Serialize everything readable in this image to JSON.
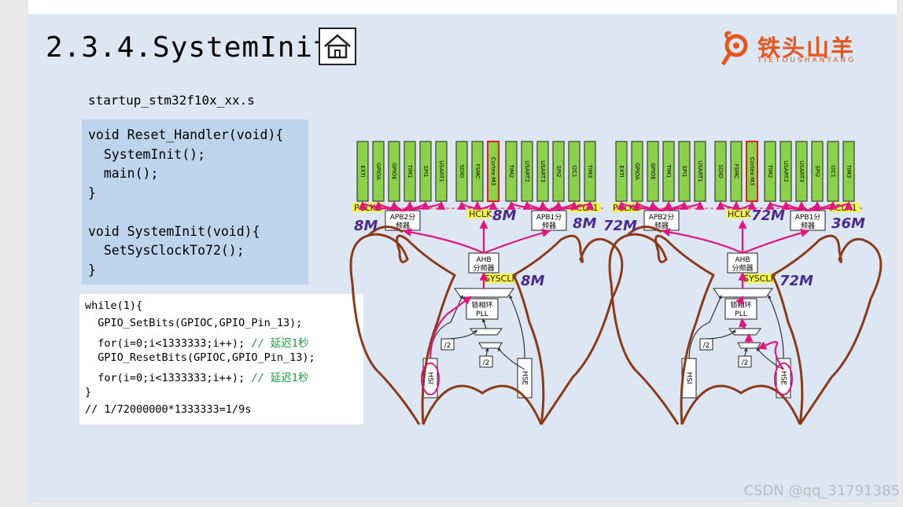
{
  "slide": {
    "title": "2.3.4.SystemInit",
    "home_icon": "home-icon",
    "logo": {
      "cn": "铁头山羊",
      "en": "TIETOUSHANYANG",
      "icon": "goat-head-icon"
    }
  },
  "code": {
    "file": "startup_stm32f10x_xx.s",
    "block1": "void Reset_Handler(void){\n  SystemInit();\n  main();\n}\n\nvoid SystemInit(void){\n  SetSysClockTo72();\n}",
    "loop": [
      {
        "text": "while(1){",
        "comment": ""
      },
      {
        "text": "  GPIO_SetBits(GPIOC,GPIO_Pin_13);",
        "comment": ""
      },
      {
        "text": "  for(i=0;i<1333333;i++);",
        "comment": " // 延迟1秒"
      },
      {
        "text": "  GPIO_ResetBits(GPIOC,GPIO_Pin_13);",
        "comment": ""
      },
      {
        "text": "  for(i=0;i<1333333;i++);",
        "comment": " // 延迟1秒"
      },
      {
        "text": "}",
        "comment": ""
      },
      {
        "text": "// 1/72000000*1333333=1/9s",
        "comment": ""
      }
    ]
  },
  "diagrams": [
    {
      "apb2_periph": [
        "EXTI",
        "GPIOA",
        "GPIOE",
        "TIM1",
        "SPI1",
        "USART1"
      ],
      "ahb_periph": [
        "SDIO",
        "FSMC",
        "Cortex-M3"
      ],
      "apb1_periph": [
        "TIM2",
        "USART2",
        "USART3",
        "SPI2",
        "I2C1",
        "TIM3"
      ],
      "pclk2": "PCLK2",
      "hclk": "HCLK",
      "pclk1": "PCLK1",
      "apb2_box": [
        "APB2分",
        "频器"
      ],
      "apb1_box": [
        "APB1分",
        "频器"
      ],
      "ahb_box": [
        "AHB",
        "分频器"
      ],
      "pll_box": [
        "锁相环",
        "PLL"
      ],
      "sysclk": "SYSCLK",
      "div2": "/2",
      "hsi": "HSI",
      "hse": "HSE",
      "hw_pclk2": "8M",
      "hw_hclk": "8M",
      "hw_pclk1": "8M",
      "hw_sysclk": "8M"
    },
    {
      "apb2_periph": [
        "EXTI",
        "GPIOA",
        "GPIOE",
        "TIM1",
        "SPI1",
        "USART1"
      ],
      "ahb_periph": [
        "SDIO",
        "FSMC",
        "Cortex-M3"
      ],
      "apb1_periph": [
        "TIM2",
        "USART2",
        "USART3",
        "SPI2",
        "I2C1",
        "TIM3"
      ],
      "pclk2": "PCLK2",
      "hclk": "HCLK",
      "pclk1": "PCLK1",
      "apb2_box": [
        "APB2分",
        "频器"
      ],
      "apb1_box": [
        "APB1分",
        "频器"
      ],
      "ahb_box": [
        "AHB",
        "分频器"
      ],
      "pll_box": [
        "锁相环",
        "PLL"
      ],
      "sysclk": "SYSCLK",
      "div2": "/2",
      "hsi": "HSI",
      "hse": "HSE",
      "hw_pclk2": "72M",
      "hw_hclk": "72M",
      "hw_pclk1": "36M",
      "hw_sysclk": "72M"
    }
  ],
  "watermark": "CSDN @qq_31791385",
  "colors": {
    "green": "#8cd14a",
    "highlight": "#f7f34a",
    "arrow": "#e2157f",
    "bowel": "#8b3b18",
    "handwriting": "#4b2a8f",
    "logo": "#e8551b",
    "comment": "#1b9e3a",
    "code_bg": "#bdd4ec",
    "slide_bg": "#dde6f3"
  }
}
